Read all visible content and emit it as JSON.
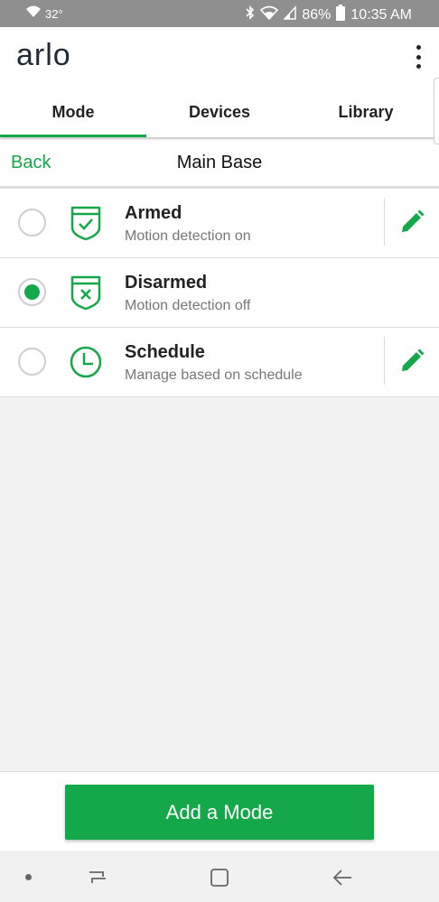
{
  "status_bar": {
    "temperature": "32°",
    "battery": "86%",
    "time": "10:35 AM"
  },
  "app": {
    "logo": "arlo",
    "menu_icon": "more-vert-icon"
  },
  "tabs": [
    {
      "label": "Mode",
      "active": true
    },
    {
      "label": "Devices",
      "active": false
    },
    {
      "label": "Library",
      "active": false
    }
  ],
  "subheader": {
    "back_label": "Back",
    "title": "Main Base"
  },
  "modes": [
    {
      "title": "Armed",
      "subtitle": "Motion detection on",
      "selected": false,
      "icon": "shield-check-icon",
      "editable": true
    },
    {
      "title": "Disarmed",
      "subtitle": "Motion detection off",
      "selected": true,
      "icon": "shield-x-icon",
      "editable": false
    },
    {
      "title": "Schedule",
      "subtitle": "Manage based on schedule",
      "selected": false,
      "icon": "clock-icon",
      "editable": true
    }
  ],
  "actions": {
    "add_mode_label": "Add a Mode"
  },
  "colors": {
    "accent": "#14a84a",
    "status_bar": "#8f8f8f"
  }
}
